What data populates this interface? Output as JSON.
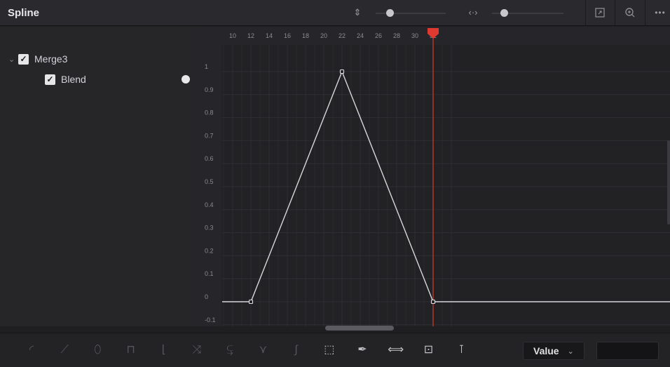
{
  "panel": {
    "title": "Spline"
  },
  "header": {
    "vertical_zoom_icon": "vertical-resize-icon",
    "horizontal_zoom_icon": "horizontal-resize-icon",
    "vertical_zoom_level": 0.15,
    "horizontal_zoom_level": 0.12,
    "buttons": [
      "zoom-to-fit-icon",
      "zoom-icon",
      "more-options-icon"
    ],
    "more_label": "•••"
  },
  "tree": {
    "items": [
      {
        "label": "Merge3",
        "checked": true,
        "expanded": true
      },
      {
        "label": "Blend",
        "checked": true
      }
    ],
    "check_glyph": "✓",
    "expand_glyph": "⌄"
  },
  "graph": {
    "frame_ticks": [
      "10",
      "12",
      "14",
      "16",
      "18",
      "20",
      "22",
      "24",
      "26",
      "28",
      "30",
      "32"
    ],
    "value_ticks": [
      "1",
      "0.9",
      "0.8",
      "0.7",
      "0.6",
      "0.5",
      "0.4",
      "0.3",
      "0.2",
      "0.1",
      "0",
      "-0.1"
    ],
    "playhead_frame": 32,
    "curve_color": "#d8d8dc",
    "playhead_color": "#d23c32",
    "keyframes": [
      {
        "frame": 12,
        "value": 0
      },
      {
        "frame": 22,
        "value": 1
      },
      {
        "frame": 32,
        "value": 0
      }
    ]
  },
  "toolbar": {
    "tools": [
      "smooth-icon",
      "linear-icon",
      "invert-icon",
      "step-in-icon",
      "step-out-icon",
      "reverse-icon",
      "time-stretch-icon",
      "ease-icon",
      "s-curve-icon",
      "select-box-icon",
      "add-point-icon",
      "expand-icon",
      "bounding-box-icon",
      "handles-icon"
    ],
    "select_value": "Value",
    "select_caret": "⌄"
  }
}
